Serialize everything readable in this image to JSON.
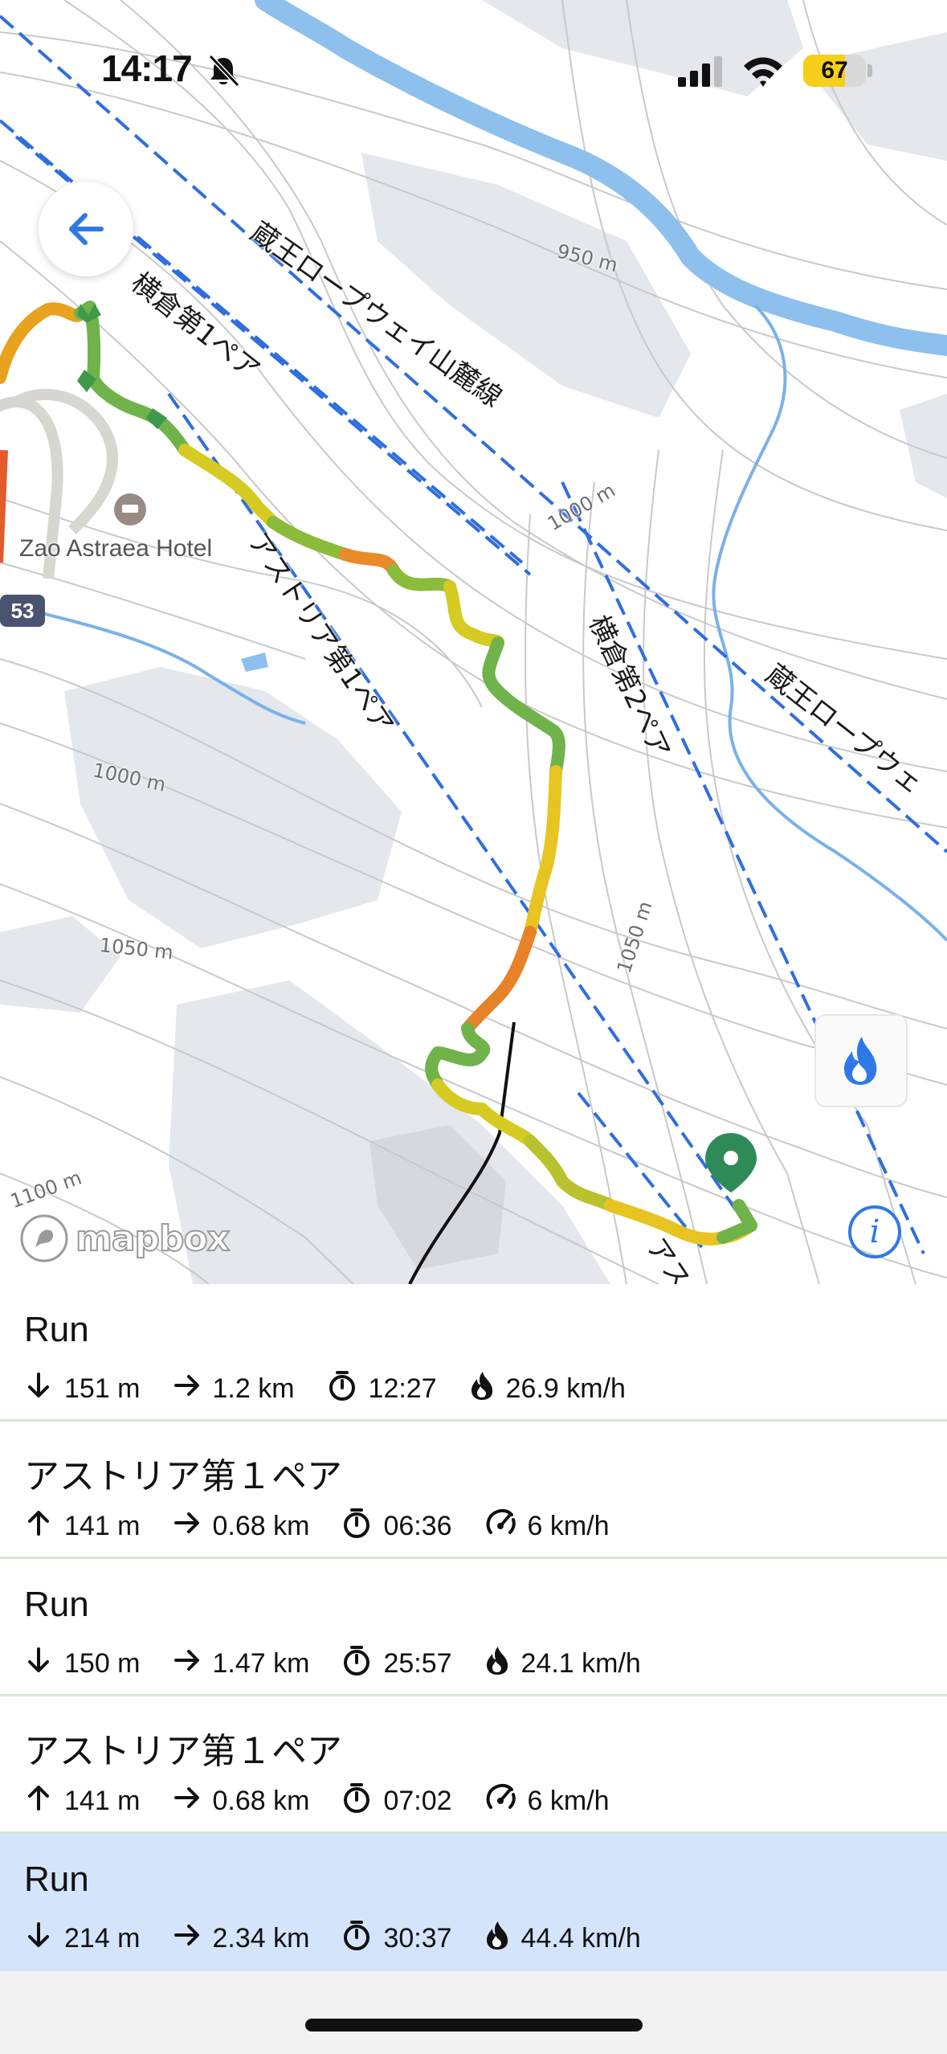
{
  "status_bar": {
    "time": "14:17",
    "battery": "67",
    "battery_level": 0.67
  },
  "map": {
    "lift_labels": [
      "蔵王ロープウェイ山麓線",
      "横倉第1ペア",
      "アストリア第1ペア",
      "横倉第2ペア",
      "蔵王ロープウェ",
      "アスト"
    ],
    "contour_labels": [
      "950 m",
      "1000 m",
      "1000 m",
      "1050 m",
      "1050 m",
      "1100 m"
    ],
    "hotel_label": "Zao Astraea Hotel",
    "road_number": "53",
    "attribution": "mapbox"
  },
  "segments": [
    {
      "title": "Run",
      "direction": "down",
      "elevation": "151 m",
      "distance": "1.2 km",
      "duration": "12:27",
      "speed_kind": "max",
      "speed": "26.9 km/h",
      "selected": false
    },
    {
      "title": "アストリア第１ペア",
      "direction": "up",
      "elevation": "141 m",
      "distance": "0.68 km",
      "duration": "06:36",
      "speed_kind": "avg",
      "speed": "6 km/h",
      "selected": false
    },
    {
      "title": "Run",
      "direction": "down",
      "elevation": "150 m",
      "distance": "1.47 km",
      "duration": "25:57",
      "speed_kind": "max",
      "speed": "24.1 km/h",
      "selected": false
    },
    {
      "title": "アストリア第１ペア",
      "direction": "up",
      "elevation": "141 m",
      "distance": "0.68 km",
      "duration": "07:02",
      "speed_kind": "avg",
      "speed": "6 km/h",
      "selected": false
    },
    {
      "title": "Run",
      "direction": "down",
      "elevation": "214 m",
      "distance": "2.34 km",
      "duration": "30:37",
      "speed_kind": "max",
      "speed": "44.4 km/h",
      "selected": true
    }
  ],
  "colors": {
    "accent": "#2f78e8",
    "selected_row": "#d4e5fb",
    "divider": "#d7e7d6",
    "pin": "#2e8b57"
  },
  "icons": [
    "bell-slash-icon",
    "signal-icon",
    "wifi-icon",
    "back-arrow-icon",
    "flame-icon",
    "info-icon",
    "map-pin-icon",
    "arrow-down-icon",
    "arrow-up-icon",
    "arrow-right-icon",
    "stopwatch-icon",
    "speedometer-icon"
  ]
}
